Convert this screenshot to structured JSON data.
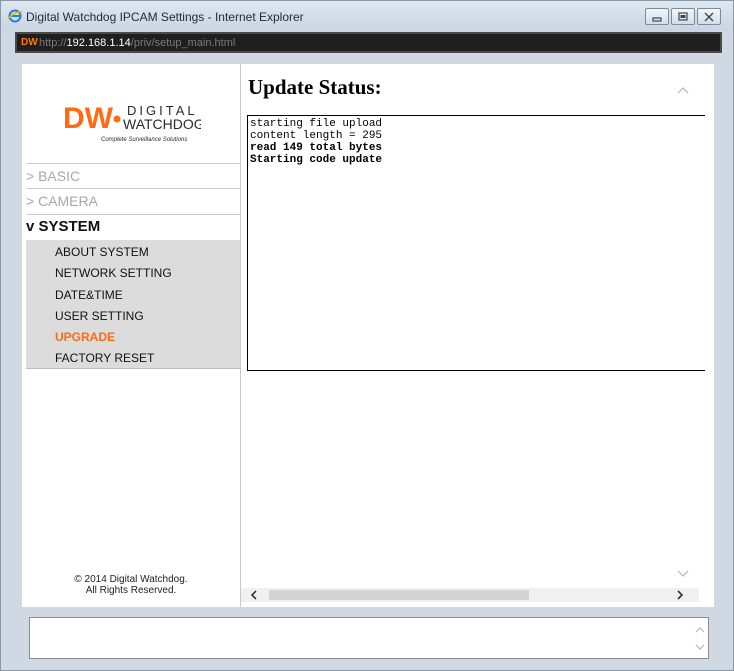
{
  "window": {
    "title": "Digital Watchdog IPCAM Settings - Internet Explorer"
  },
  "address_bar": {
    "logo": "DW",
    "url_prefix": "http://",
    "url_host": "192.168.1.14",
    "url_path": "/priv/setup_main.html"
  },
  "brand": {
    "logo_top": "DIGITAL",
    "logo_bottom": "WATCHDOG.",
    "tagline": "Complete Surveillance Solutions",
    "accent_color": "#ff6a13"
  },
  "nav": {
    "basic": "> BASIC",
    "camera": "> CAMERA",
    "system": "v SYSTEM",
    "system_items": [
      {
        "label": "ABOUT SYSTEM"
      },
      {
        "label": "NETWORK SETTING"
      },
      {
        "label": "DATE&TIME"
      },
      {
        "label": "USER SETTING"
      },
      {
        "label": "UPGRADE"
      },
      {
        "label": "FACTORY RESET"
      }
    ],
    "active_item": "UPGRADE"
  },
  "footer": {
    "copyright_line1": "© 2014 Digital Watchdog.",
    "copyright_line2": "All Rights Reserved."
  },
  "main": {
    "title": "Update Status:",
    "status_lines": [
      {
        "text": "starting file upload",
        "bold": false
      },
      {
        "text": "content length = 295",
        "bold": false
      },
      {
        "text": "read 149 total bytes",
        "bold": true
      },
      {
        "text": "Starting code update",
        "bold": true
      }
    ]
  }
}
